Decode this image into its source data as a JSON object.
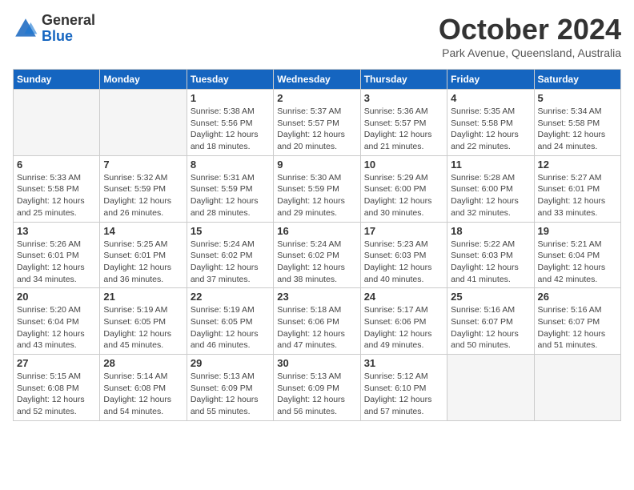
{
  "header": {
    "logo_general": "General",
    "logo_blue": "Blue",
    "month_title": "October 2024",
    "subtitle": "Park Avenue, Queensland, Australia"
  },
  "days_of_week": [
    "Sunday",
    "Monday",
    "Tuesday",
    "Wednesday",
    "Thursday",
    "Friday",
    "Saturday"
  ],
  "weeks": [
    [
      {
        "day": "",
        "empty": true
      },
      {
        "day": "",
        "empty": true
      },
      {
        "day": "1",
        "sunrise": "Sunrise: 5:38 AM",
        "sunset": "Sunset: 5:56 PM",
        "daylight": "Daylight: 12 hours and 18 minutes."
      },
      {
        "day": "2",
        "sunrise": "Sunrise: 5:37 AM",
        "sunset": "Sunset: 5:57 PM",
        "daylight": "Daylight: 12 hours and 20 minutes."
      },
      {
        "day": "3",
        "sunrise": "Sunrise: 5:36 AM",
        "sunset": "Sunset: 5:57 PM",
        "daylight": "Daylight: 12 hours and 21 minutes."
      },
      {
        "day": "4",
        "sunrise": "Sunrise: 5:35 AM",
        "sunset": "Sunset: 5:58 PM",
        "daylight": "Daylight: 12 hours and 22 minutes."
      },
      {
        "day": "5",
        "sunrise": "Sunrise: 5:34 AM",
        "sunset": "Sunset: 5:58 PM",
        "daylight": "Daylight: 12 hours and 24 minutes."
      }
    ],
    [
      {
        "day": "6",
        "sunrise": "Sunrise: 5:33 AM",
        "sunset": "Sunset: 5:58 PM",
        "daylight": "Daylight: 12 hours and 25 minutes."
      },
      {
        "day": "7",
        "sunrise": "Sunrise: 5:32 AM",
        "sunset": "Sunset: 5:59 PM",
        "daylight": "Daylight: 12 hours and 26 minutes."
      },
      {
        "day": "8",
        "sunrise": "Sunrise: 5:31 AM",
        "sunset": "Sunset: 5:59 PM",
        "daylight": "Daylight: 12 hours and 28 minutes."
      },
      {
        "day": "9",
        "sunrise": "Sunrise: 5:30 AM",
        "sunset": "Sunset: 5:59 PM",
        "daylight": "Daylight: 12 hours and 29 minutes."
      },
      {
        "day": "10",
        "sunrise": "Sunrise: 5:29 AM",
        "sunset": "Sunset: 6:00 PM",
        "daylight": "Daylight: 12 hours and 30 minutes."
      },
      {
        "day": "11",
        "sunrise": "Sunrise: 5:28 AM",
        "sunset": "Sunset: 6:00 PM",
        "daylight": "Daylight: 12 hours and 32 minutes."
      },
      {
        "day": "12",
        "sunrise": "Sunrise: 5:27 AM",
        "sunset": "Sunset: 6:01 PM",
        "daylight": "Daylight: 12 hours and 33 minutes."
      }
    ],
    [
      {
        "day": "13",
        "sunrise": "Sunrise: 5:26 AM",
        "sunset": "Sunset: 6:01 PM",
        "daylight": "Daylight: 12 hours and 34 minutes."
      },
      {
        "day": "14",
        "sunrise": "Sunrise: 5:25 AM",
        "sunset": "Sunset: 6:01 PM",
        "daylight": "Daylight: 12 hours and 36 minutes."
      },
      {
        "day": "15",
        "sunrise": "Sunrise: 5:24 AM",
        "sunset": "Sunset: 6:02 PM",
        "daylight": "Daylight: 12 hours and 37 minutes."
      },
      {
        "day": "16",
        "sunrise": "Sunrise: 5:24 AM",
        "sunset": "Sunset: 6:02 PM",
        "daylight": "Daylight: 12 hours and 38 minutes."
      },
      {
        "day": "17",
        "sunrise": "Sunrise: 5:23 AM",
        "sunset": "Sunset: 6:03 PM",
        "daylight": "Daylight: 12 hours and 40 minutes."
      },
      {
        "day": "18",
        "sunrise": "Sunrise: 5:22 AM",
        "sunset": "Sunset: 6:03 PM",
        "daylight": "Daylight: 12 hours and 41 minutes."
      },
      {
        "day": "19",
        "sunrise": "Sunrise: 5:21 AM",
        "sunset": "Sunset: 6:04 PM",
        "daylight": "Daylight: 12 hours and 42 minutes."
      }
    ],
    [
      {
        "day": "20",
        "sunrise": "Sunrise: 5:20 AM",
        "sunset": "Sunset: 6:04 PM",
        "daylight": "Daylight: 12 hours and 43 minutes."
      },
      {
        "day": "21",
        "sunrise": "Sunrise: 5:19 AM",
        "sunset": "Sunset: 6:05 PM",
        "daylight": "Daylight: 12 hours and 45 minutes."
      },
      {
        "day": "22",
        "sunrise": "Sunrise: 5:19 AM",
        "sunset": "Sunset: 6:05 PM",
        "daylight": "Daylight: 12 hours and 46 minutes."
      },
      {
        "day": "23",
        "sunrise": "Sunrise: 5:18 AM",
        "sunset": "Sunset: 6:06 PM",
        "daylight": "Daylight: 12 hours and 47 minutes."
      },
      {
        "day": "24",
        "sunrise": "Sunrise: 5:17 AM",
        "sunset": "Sunset: 6:06 PM",
        "daylight": "Daylight: 12 hours and 49 minutes."
      },
      {
        "day": "25",
        "sunrise": "Sunrise: 5:16 AM",
        "sunset": "Sunset: 6:07 PM",
        "daylight": "Daylight: 12 hours and 50 minutes."
      },
      {
        "day": "26",
        "sunrise": "Sunrise: 5:16 AM",
        "sunset": "Sunset: 6:07 PM",
        "daylight": "Daylight: 12 hours and 51 minutes."
      }
    ],
    [
      {
        "day": "27",
        "sunrise": "Sunrise: 5:15 AM",
        "sunset": "Sunset: 6:08 PM",
        "daylight": "Daylight: 12 hours and 52 minutes."
      },
      {
        "day": "28",
        "sunrise": "Sunrise: 5:14 AM",
        "sunset": "Sunset: 6:08 PM",
        "daylight": "Daylight: 12 hours and 54 minutes."
      },
      {
        "day": "29",
        "sunrise": "Sunrise: 5:13 AM",
        "sunset": "Sunset: 6:09 PM",
        "daylight": "Daylight: 12 hours and 55 minutes."
      },
      {
        "day": "30",
        "sunrise": "Sunrise: 5:13 AM",
        "sunset": "Sunset: 6:09 PM",
        "daylight": "Daylight: 12 hours and 56 minutes."
      },
      {
        "day": "31",
        "sunrise": "Sunrise: 5:12 AM",
        "sunset": "Sunset: 6:10 PM",
        "daylight": "Daylight: 12 hours and 57 minutes."
      },
      {
        "day": "",
        "empty": true
      },
      {
        "day": "",
        "empty": true
      }
    ]
  ]
}
